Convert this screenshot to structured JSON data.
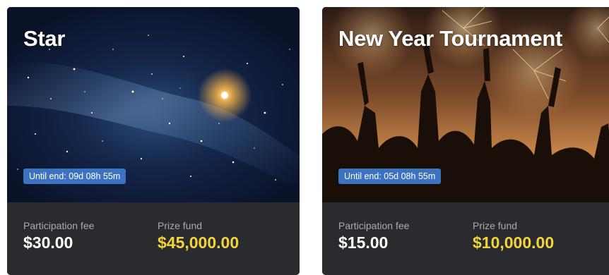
{
  "cards": [
    {
      "title": "Star",
      "timer": "Until end: 09d 08h 55m",
      "fee_label": "Participation fee",
      "fee_value": "$30.00",
      "prize_label": "Prize fund",
      "prize_value": "$45,000.00"
    },
    {
      "title": "New Year Tournament",
      "timer": "Until end: 05d 08h 55m",
      "fee_label": "Participation fee",
      "fee_value": "$15.00",
      "prize_label": "Prize fund",
      "prize_value": "$10,000.00"
    }
  ],
  "colors": {
    "card_footer_bg": "#2a2b2f",
    "timer_badge_bg": "#3d72c0",
    "prize_value": "#f2d43b",
    "label_gray": "#a9abb0"
  }
}
